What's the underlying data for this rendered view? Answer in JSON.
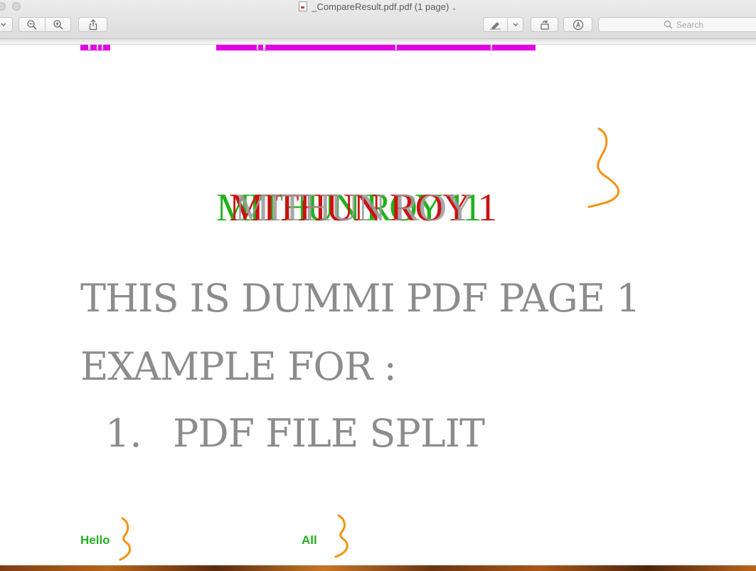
{
  "window": {
    "title": "_CompareResult.pdf.pdf (1 page)",
    "title_chevron": "⌄"
  },
  "toolbar": {
    "search_placeholder": "Search"
  },
  "document": {
    "name_green": "MITHUN ROY 11",
    "name_red": "MITHUN ROY 1",
    "name_gray": "MITHUN ROY",
    "line1": "THIS IS DUMMI PDF PAGE 1",
    "line2": "EXAMPLE FOR :",
    "list_number": "1.",
    "list_item": "PDF FILE SPLIT",
    "word_hello": "Hello",
    "word_all": "All"
  },
  "colors": {
    "insert_green": "#22b11c",
    "delete_red": "#cc1111",
    "highlight_magenta": "#e400e4",
    "annotation_orange": "#f39312",
    "unchanged_gray": "#8c8c8c"
  }
}
